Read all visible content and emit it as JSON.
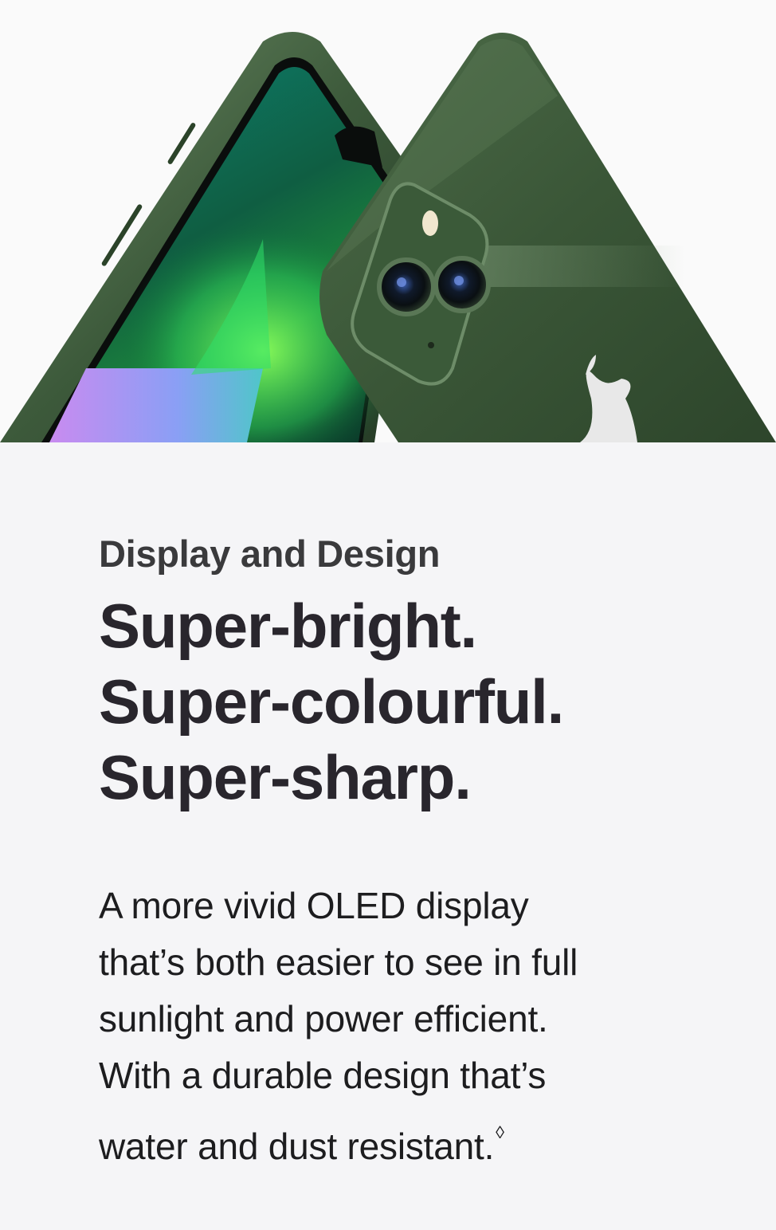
{
  "hero": {
    "image_name": "green-phone-front-and-back"
  },
  "section": {
    "eyebrow": "Display and Design",
    "headline_lines": [
      "Super-bright.",
      "Super-colourful.",
      "Super-sharp."
    ],
    "body_line_1": "A more vivid OLED display",
    "body_line_2": "that’s both easier to see in full",
    "body_line_3": "sunlight and power efficient.",
    "body_line_4": "With a durable design that’s",
    "body_line_5": "water and dust resistant.",
    "footnote_symbol": "◊"
  },
  "colors": {
    "page_background": "#f5f5f7",
    "text_primary": "#1d1d1f",
    "phone_green": "#3f5b3e"
  }
}
